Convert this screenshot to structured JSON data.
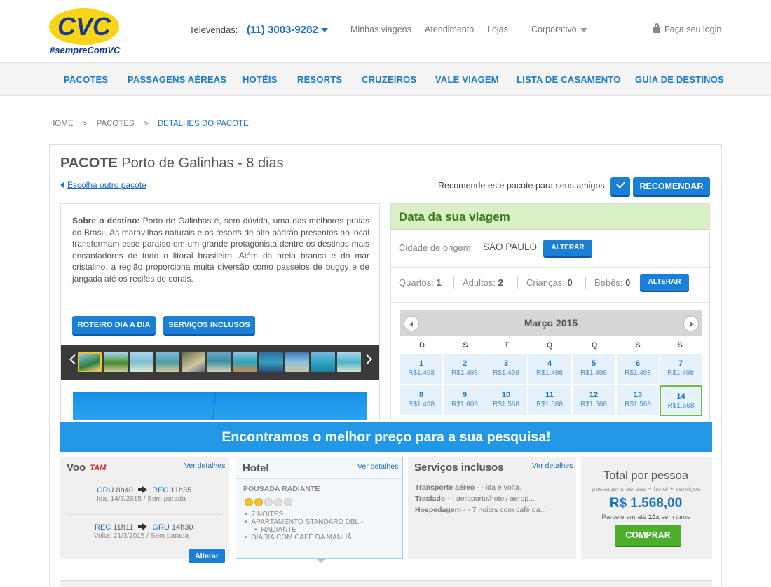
{
  "header": {
    "logo_text": "CVC",
    "hashtag": "#sempreComVC",
    "televendas_label": "Televendas:",
    "phone": "(11) 3003-9282",
    "links": [
      "Minhas viagens",
      "Atendimento",
      "Lojas"
    ],
    "corporate": "Corporativo",
    "login": "Faça seu login"
  },
  "nav": [
    "PACOTES",
    "PASSAGENS AÉREAS",
    "HOTÉIS",
    "RESORTS",
    "CRUZEIROS",
    "VALE VIAGEM",
    "LISTA DE CASAMENTO",
    "GUIA DE DESTINOS"
  ],
  "breadcrumb": [
    "HOME",
    ">",
    "PACOTES",
    ">",
    "DETALHES DO PACOTE"
  ],
  "package": {
    "title_prefix": "PACOTE",
    "title": "Porto de Galinhas - 8 dias",
    "back_link": "Escolha outro pacote",
    "recommend_text": "Recomende este pacote para seus amigos:",
    "recommend_btn": "RECOMENDAR"
  },
  "description": {
    "label": "Sobre o destino:",
    "text": "Porto de Galinhas é, sem dúvida, uma das melhores praias do Brasil. As maravilhas naturais e os resorts de alto padrão presentes no local transformam esse paraíso em um grande protagonista dentre os destinos mais encantadores de todo o litoral brasileiro. Além da areia branca e do mar cristalino, a região proporciona muita diversão como passeios de buggy e de jangada até os recifes de corais.",
    "btn_roteiro": "ROTEIRO DIA A DIA",
    "btn_servicos": "SERVIÇOS INCLUSOS"
  },
  "trip": {
    "header": "Data da sua viagem",
    "origin_label": "Cidade de origem:",
    "origin_value": "SÃO PAULO",
    "alter": "ALTERAR",
    "quartos_label": "Quartos:",
    "quartos": "1",
    "adultos_label": "Adultos:",
    "adultos": "2",
    "criancas_label": "Crianças:",
    "criancas": "0",
    "bebes_label": "Bebês:",
    "bebes": "0",
    "month": "Março 2015",
    "dow": [
      "D",
      "S",
      "T",
      "Q",
      "Q",
      "S",
      "S"
    ],
    "days": [
      {
        "d": "1",
        "p": "R$1.498"
      },
      {
        "d": "2",
        "p": "R$1.498"
      },
      {
        "d": "3",
        "p": "R$1.498"
      },
      {
        "d": "4",
        "p": "R$1.498"
      },
      {
        "d": "5",
        "p": "R$1.498"
      },
      {
        "d": "6",
        "p": "R$1.498"
      },
      {
        "d": "7",
        "p": "R$1.498"
      },
      {
        "d": "8",
        "p": "R$1.498"
      },
      {
        "d": "9",
        "p": "R$1.608"
      },
      {
        "d": "10",
        "p": "R$1.568"
      },
      {
        "d": "11",
        "p": "R$1.568"
      },
      {
        "d": "12",
        "p": "R$1.568"
      },
      {
        "d": "13",
        "p": "R$1.568"
      },
      {
        "d": "14",
        "p": "R$1.568"
      }
    ],
    "selected_day": "14"
  },
  "banner": "Encontramos o melhor preço para a sua pesquisa!",
  "flight": {
    "title": "Voo",
    "airline": "TAM",
    "details": "Ver detalhes",
    "out_from": "GRU",
    "out_dep": "8h40",
    "out_to": "REC",
    "out_arr": "11h35",
    "out_sub": "Ida: 14/3/2015 / Sem parada",
    "ret_from": "REC",
    "ret_dep": "11h11",
    "ret_to": "GRU",
    "ret_arr": "14h30",
    "ret_sub": "Volta: 21/3/2015 / Sem parada",
    "alter": "Alterar"
  },
  "hotel": {
    "title": "Hotel",
    "details": "Ver detalhes",
    "name": "POUSADA RADIANTE",
    "rating": 2,
    "items": [
      "7 NOITES",
      "APARTAMENTO STANDARD DBL -",
      "RADIANTE",
      "DIÁRIA COM CAFÉ DA MANHÃ"
    ]
  },
  "services": {
    "title": "Serviços inclusos",
    "details": "Ver detalhes",
    "lines": [
      {
        "label": "Transporte aéreo",
        "text": " - - ida e volta."
      },
      {
        "label": "Traslado",
        "text": " - - aeroporto/hotel/ aerop..."
      },
      {
        "label": "Hospedagem",
        "text": " - - 7 noites com café da..."
      }
    ]
  },
  "total": {
    "title": "Total por pessoa",
    "sub": "passagens aéreas + hotel + serviços",
    "price": "R$ 1.568,00",
    "inst_prefix": "Parcele em até",
    "inst_bold": "10x",
    "inst_suffix": "sem juros",
    "buy": "COMPRAR"
  },
  "colors": {
    "brand_blue": "#1a7fd6",
    "banner_blue": "#2197e6",
    "green": "#4cae2c",
    "date_header": "#d9f0c7"
  }
}
